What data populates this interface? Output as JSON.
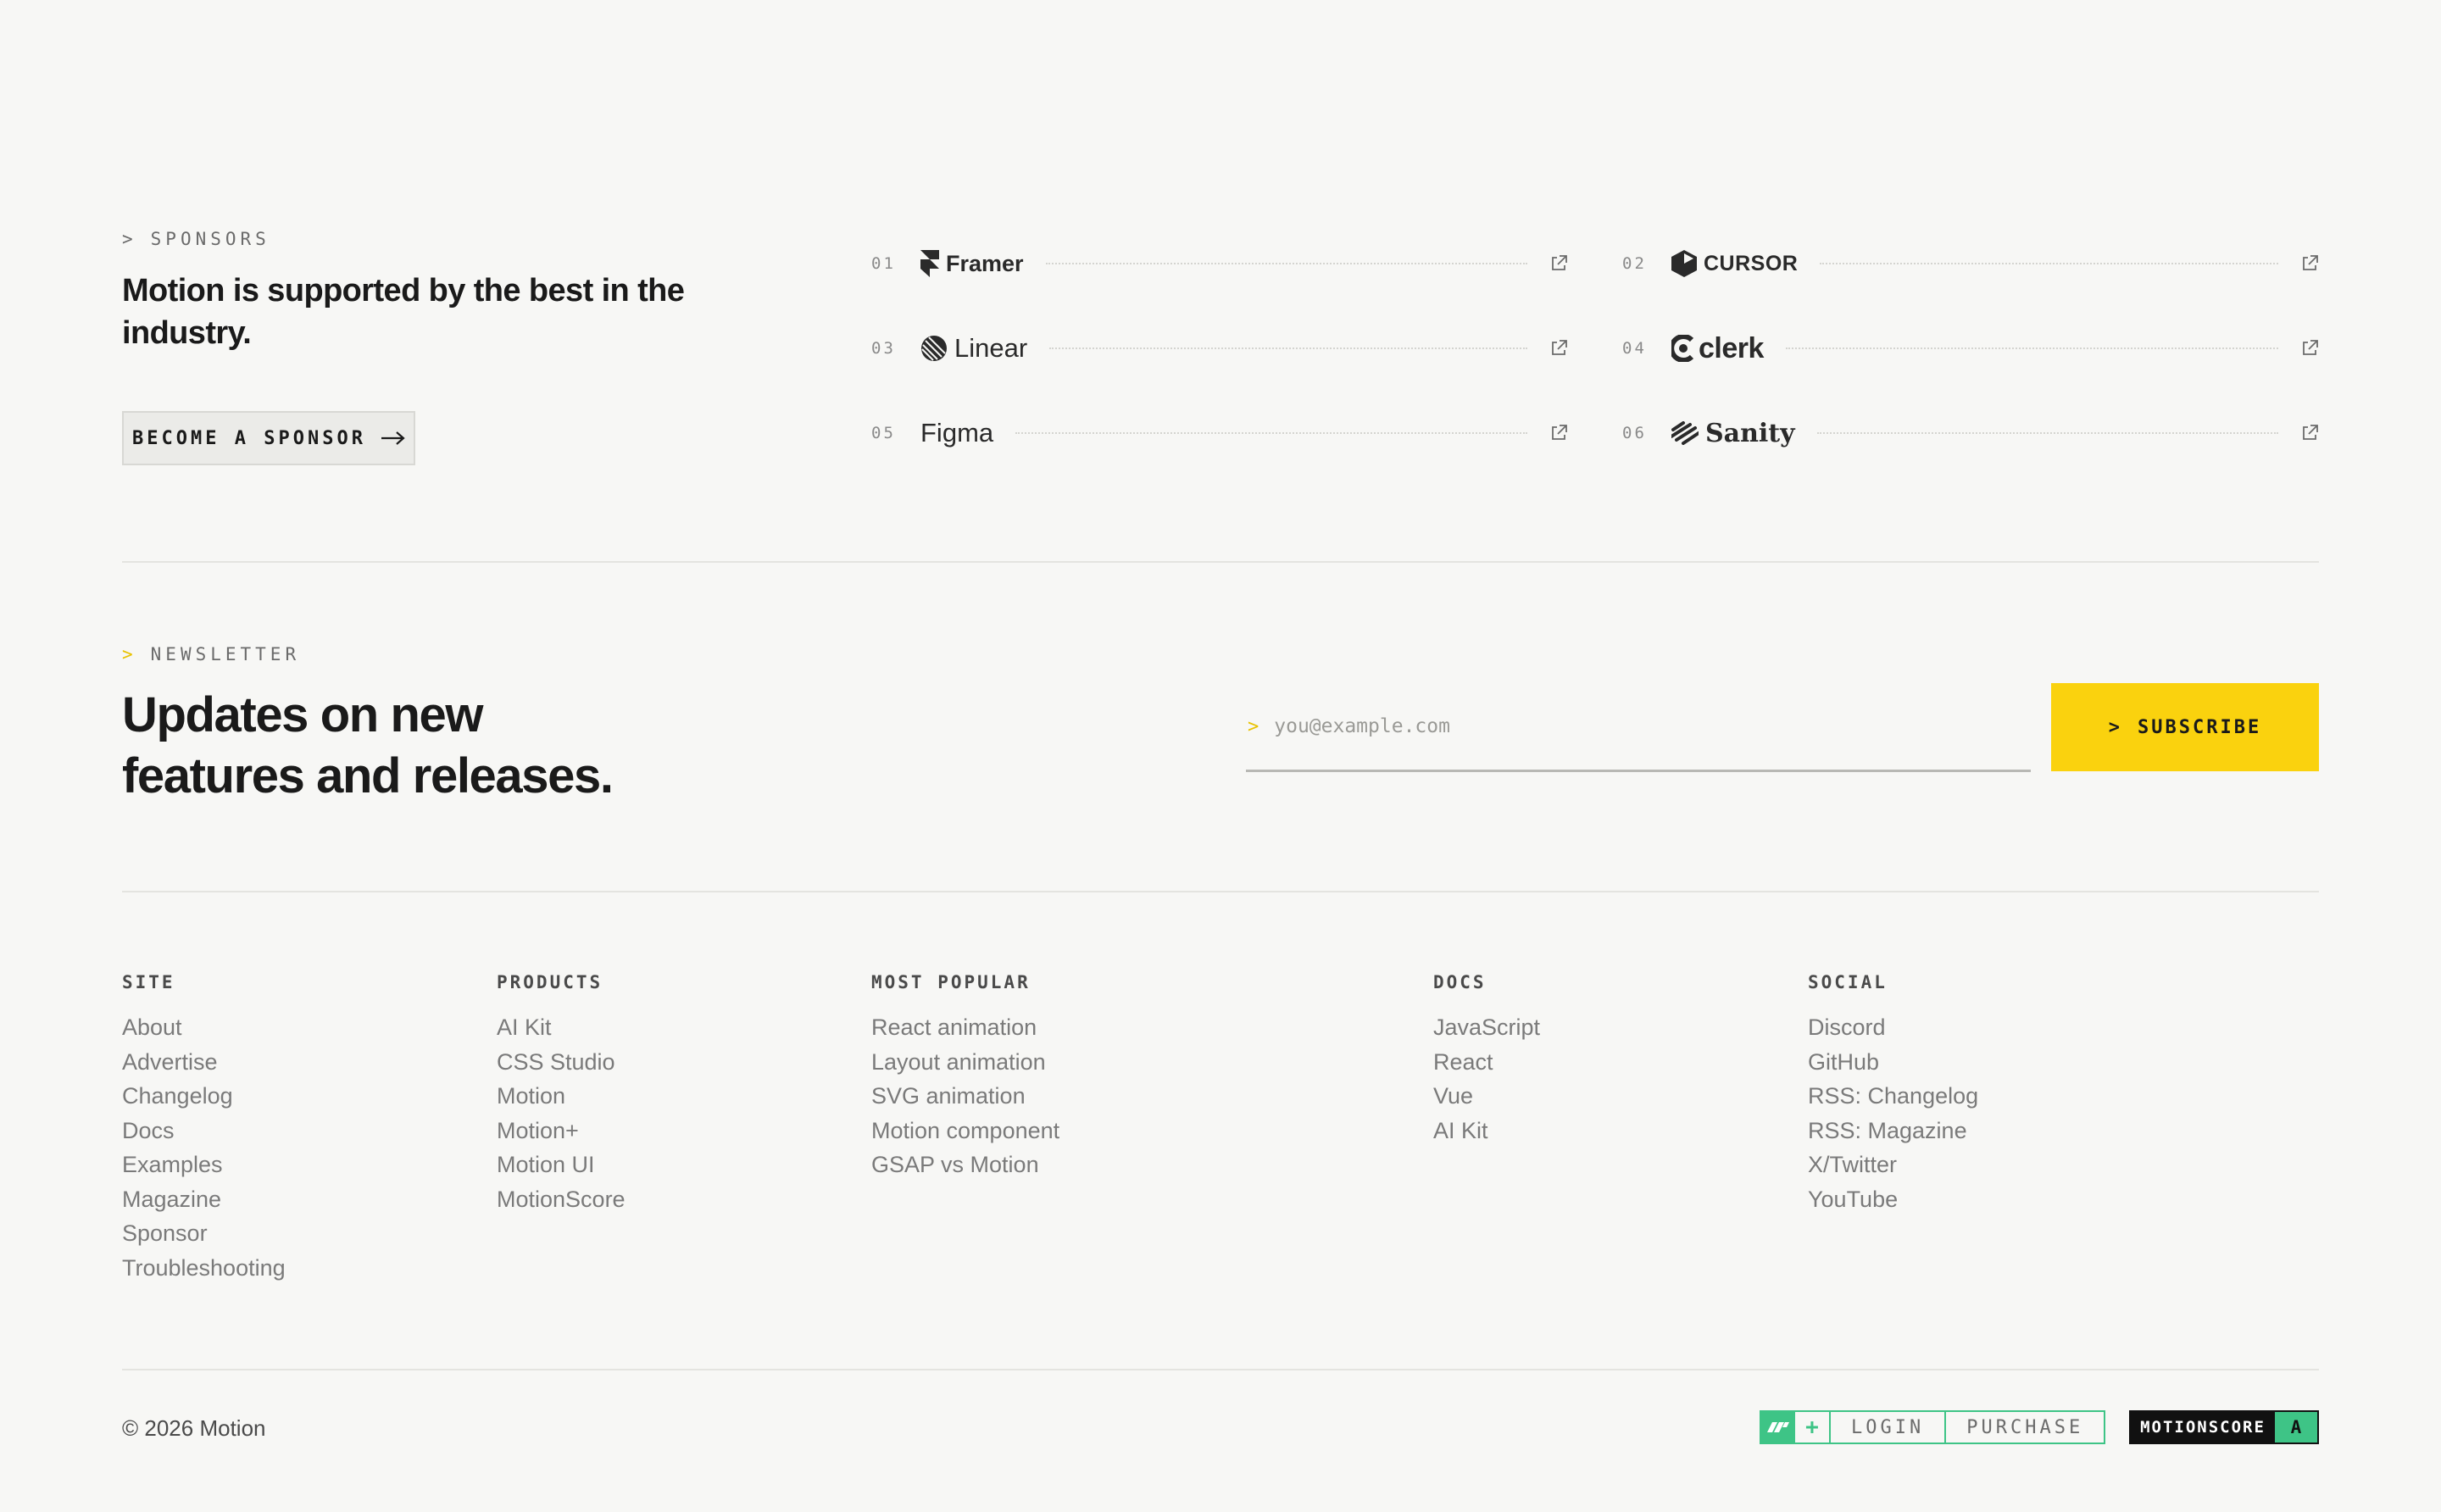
{
  "sponsors": {
    "eyebrow_caret": ">",
    "eyebrow": "SPONSORS",
    "heading": "Motion is supported by the best in the industry.",
    "become_label": "BECOME A SPONSOR",
    "items": [
      {
        "num": "01",
        "name": "Framer",
        "icon": "framer-logo-icon"
      },
      {
        "num": "02",
        "name": "CURSOR",
        "icon": "cursor-logo-icon"
      },
      {
        "num": "03",
        "name": "Linear",
        "icon": "linear-logo-icon"
      },
      {
        "num": "04",
        "name": "clerk",
        "icon": "clerk-logo-icon"
      },
      {
        "num": "05",
        "name": "Figma",
        "icon": ""
      },
      {
        "num": "06",
        "name": "Sanity",
        "icon": "sanity-logo-icon"
      }
    ]
  },
  "newsletter": {
    "eyebrow_caret": ">",
    "eyebrow": "NEWSLETTER",
    "heading_line1": "Updates on new",
    "heading_line2": "features and releases.",
    "input_caret": ">",
    "placeholder": "you@example.com",
    "subscribe_caret": ">",
    "subscribe_label": "SUBSCRIBE"
  },
  "footer": {
    "columns": [
      {
        "title": "SITE",
        "links": [
          "About",
          "Advertise",
          "Changelog",
          "Docs",
          "Examples",
          "Magazine",
          "Sponsor",
          "Troubleshooting"
        ]
      },
      {
        "title": "PRODUCTS",
        "links": [
          "AI Kit",
          "CSS Studio",
          "Motion",
          "Motion+",
          "Motion UI",
          "MotionScore"
        ]
      },
      {
        "title": "MOST POPULAR",
        "links": [
          "React animation",
          "Layout animation",
          "SVG animation",
          "Motion component",
          "GSAP vs Motion"
        ]
      },
      {
        "title": "DOCS",
        "links": [
          "JavaScript",
          "React",
          "Vue",
          "AI Kit"
        ]
      },
      {
        "title": "SOCIAL",
        "links": [
          "Discord",
          "GitHub",
          "RSS: Changelog",
          "RSS: Magazine",
          "X/Twitter",
          "YouTube"
        ]
      }
    ],
    "copyright": "© 2026 Motion",
    "motion_plus": {
      "plus": "+",
      "login": "LOGIN",
      "purchase": "PURCHASE"
    },
    "motionscore": {
      "label": "MOTIONSCORE",
      "grade": "A"
    }
  },
  "colors": {
    "accent_yellow": "#fad20e",
    "accent_green": "#3ec486",
    "background": "#f7f7f5"
  }
}
